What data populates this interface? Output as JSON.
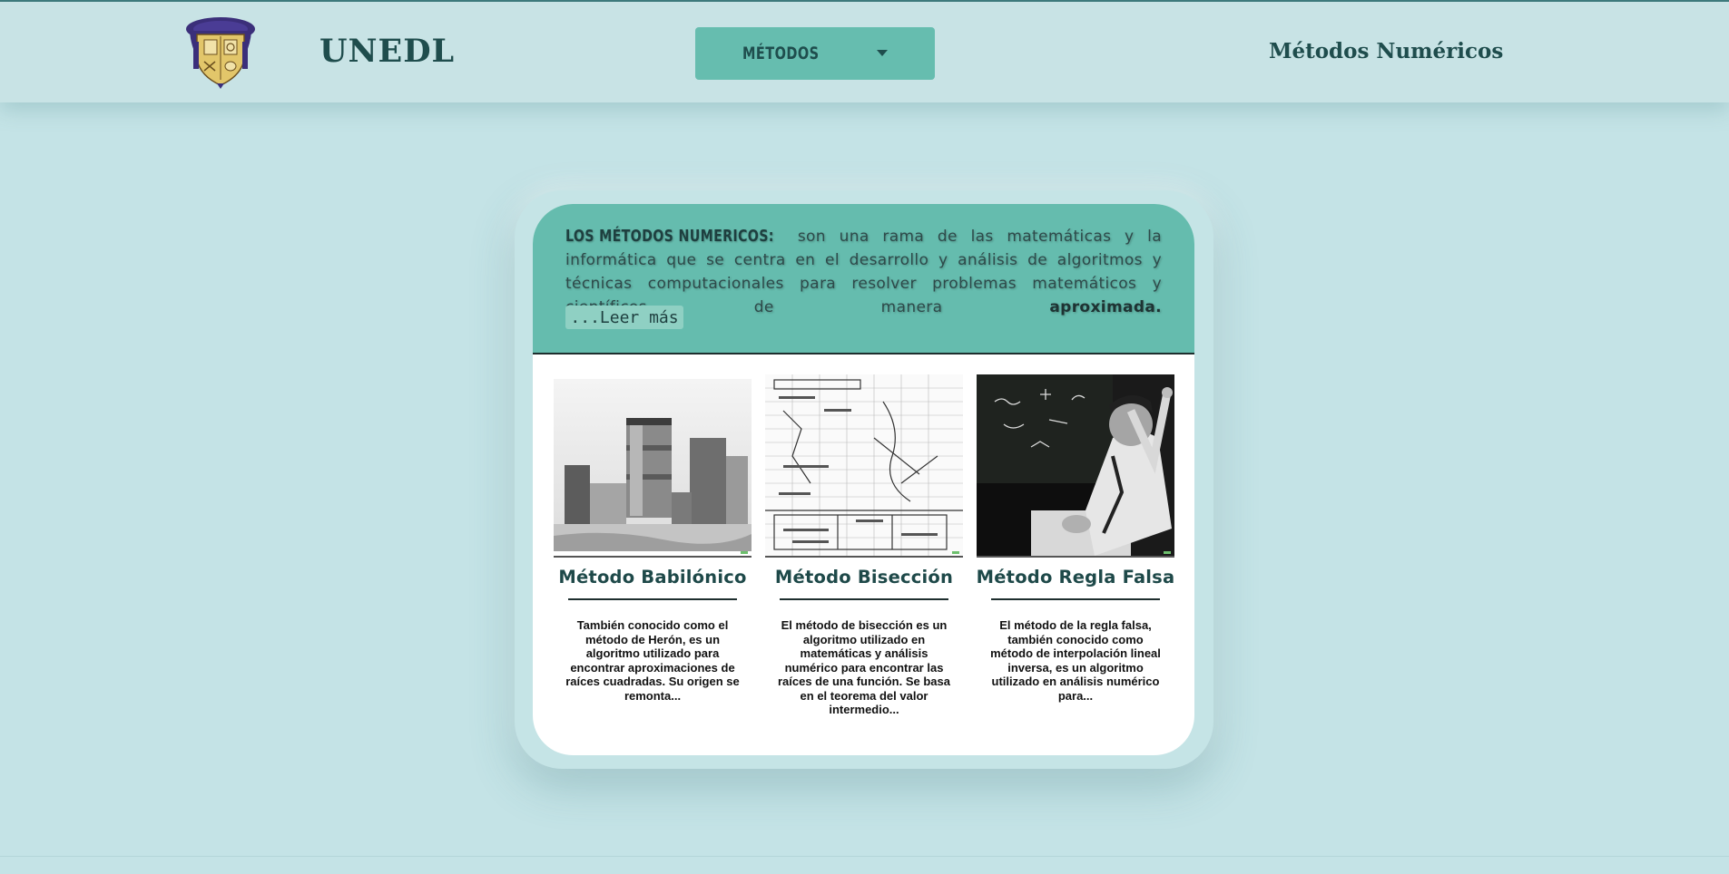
{
  "header": {
    "brand": "UNEDL",
    "dropdown_label": "MÉTODOS",
    "site_title": "Métodos Numéricos",
    "logo_icon": "university-crest-icon"
  },
  "intro": {
    "heading": "LOS MÉTODOS NUMERICOS:",
    "body": " son una rama de las matemáticas y la informática que se centra en el desarrollo y análisis de algoritmos y técnicas computacionales para resolver problemas matemáticos y científicos de manera ",
    "emphasis": "aproximada.",
    "read_more": "...Leer más"
  },
  "methods": [
    {
      "title": "Método Babilónico",
      "description": "También conocido como el método de Herón, es un algoritmo utilizado para encontrar aproximaciones de raíces cuadradas. Su origen se remonta...",
      "image_icon": "ancient-tower-photo"
    },
    {
      "title": "Método Bisección",
      "description": "El método de bisección es un algoritmo utilizado en matemáticas y análisis numérico para encontrar las raíces de una función. Se basa en el teorema del valor intermedio...",
      "image_icon": "technical-drawing-photo"
    },
    {
      "title": "Método Regla Falsa",
      "description": "El método de la regla falsa, también conocido como método de interpolación lineal inversa, es un algoritmo utilizado en análisis numérico para...",
      "image_icon": "man-at-blackboard-photo"
    }
  ],
  "colors": {
    "background": "#c4e3e6",
    "accent": "#65bcae",
    "text_dark": "#1f4d4d"
  }
}
